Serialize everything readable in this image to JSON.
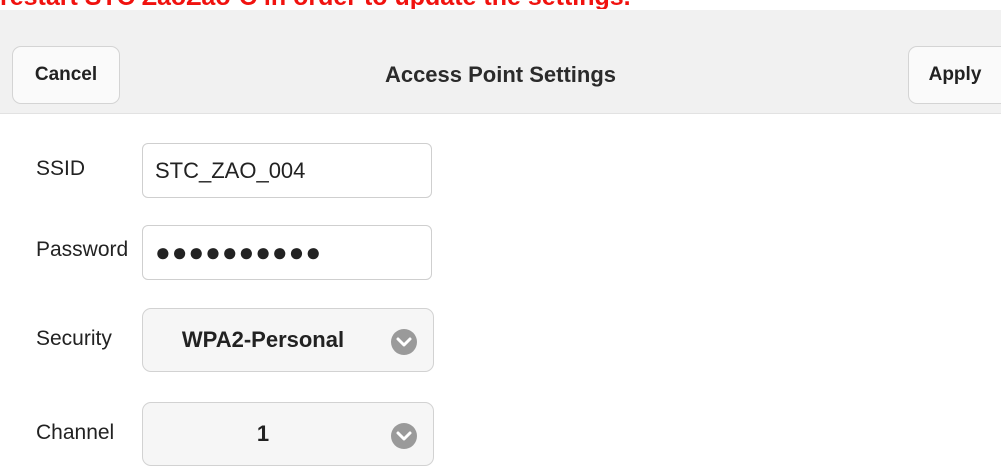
{
  "notice": "restart STC ZaoZao-C in order to update the settings.",
  "header": {
    "title": "Access Point Settings",
    "cancel_label": "Cancel",
    "apply_label": "Apply"
  },
  "form": {
    "ssid": {
      "label": "SSID",
      "value": "STC_ZAO_004"
    },
    "password": {
      "label": "Password",
      "value": "●●●●●●●●●●"
    },
    "security": {
      "label": "Security",
      "value": "WPA2-Personal"
    },
    "channel": {
      "label": "Channel",
      "value": "1"
    }
  },
  "icons": {
    "dropdown": "chevron-down-icon"
  }
}
